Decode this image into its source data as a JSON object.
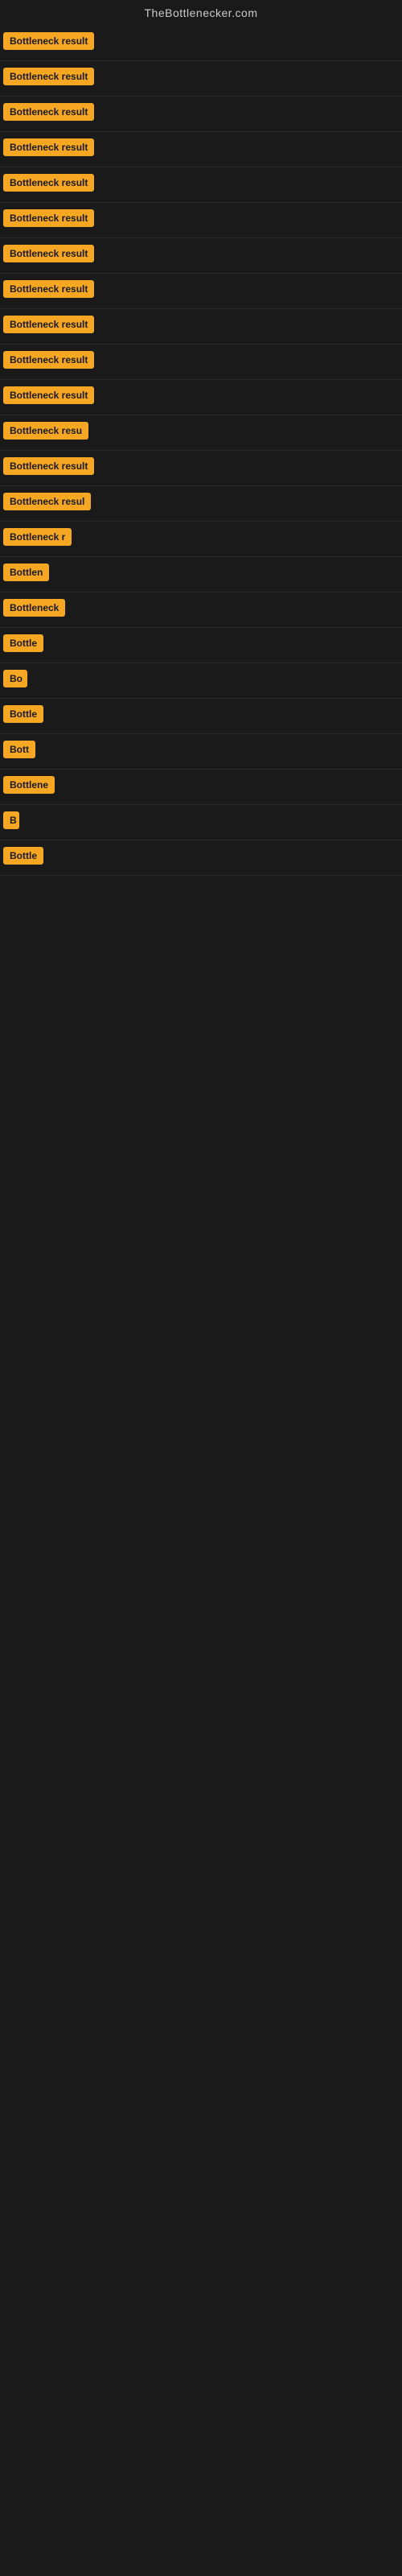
{
  "site": {
    "title": "TheBottlenecker.com"
  },
  "rows": [
    {
      "id": 1,
      "label": "Bottleneck result",
      "badge_width": 120
    },
    {
      "id": 2,
      "label": "Bottleneck result",
      "badge_width": 120
    },
    {
      "id": 3,
      "label": "Bottleneck result",
      "badge_width": 120
    },
    {
      "id": 4,
      "label": "Bottleneck result",
      "badge_width": 120
    },
    {
      "id": 5,
      "label": "Bottleneck result",
      "badge_width": 120
    },
    {
      "id": 6,
      "label": "Bottleneck result",
      "badge_width": 120
    },
    {
      "id": 7,
      "label": "Bottleneck result",
      "badge_width": 120
    },
    {
      "id": 8,
      "label": "Bottleneck result",
      "badge_width": 120
    },
    {
      "id": 9,
      "label": "Bottleneck result",
      "badge_width": 120
    },
    {
      "id": 10,
      "label": "Bottleneck result",
      "badge_width": 120
    },
    {
      "id": 11,
      "label": "Bottleneck result",
      "badge_width": 120
    },
    {
      "id": 12,
      "label": "Bottleneck resu",
      "badge_width": 108
    },
    {
      "id": 13,
      "label": "Bottleneck result",
      "badge_width": 115
    },
    {
      "id": 14,
      "label": "Bottleneck resul",
      "badge_width": 110
    },
    {
      "id": 15,
      "label": "Bottleneck r",
      "badge_width": 88
    },
    {
      "id": 16,
      "label": "Bottlen",
      "badge_width": 68
    },
    {
      "id": 17,
      "label": "Bottleneck",
      "badge_width": 78
    },
    {
      "id": 18,
      "label": "Bottle",
      "badge_width": 58
    },
    {
      "id": 19,
      "label": "Bo",
      "badge_width": 30
    },
    {
      "id": 20,
      "label": "Bottle",
      "badge_width": 58
    },
    {
      "id": 21,
      "label": "Bott",
      "badge_width": 42
    },
    {
      "id": 22,
      "label": "Bottlene",
      "badge_width": 68
    },
    {
      "id": 23,
      "label": "B",
      "badge_width": 20
    },
    {
      "id": 24,
      "label": "Bottle",
      "badge_width": 58
    }
  ]
}
